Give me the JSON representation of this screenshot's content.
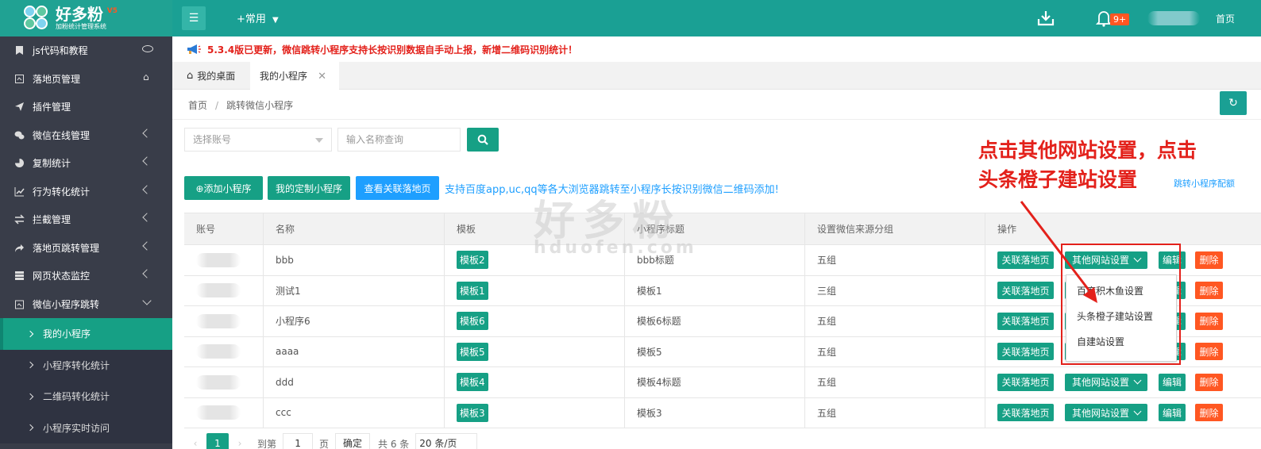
{
  "header": {
    "logo_title": "好多粉",
    "logo_version": "V5",
    "logo_subtitle": "加粉统计管理系统",
    "common_menu": "+常用",
    "badge": "9+",
    "home_link": "首页"
  },
  "sidebar": {
    "items": [
      {
        "label": "js代码和教程",
        "icon": "bookmark-icon",
        "suffix": "eye"
      },
      {
        "label": "落地页管理",
        "icon": "page-icon",
        "suffix": "home"
      },
      {
        "label": "插件管理",
        "icon": "send-icon",
        "suffix": ""
      },
      {
        "label": "微信在线管理",
        "icon": "wechat-icon",
        "suffix": "arrow"
      },
      {
        "label": "复制统计",
        "icon": "pie-icon",
        "suffix": "arrow"
      },
      {
        "label": "行为转化统计",
        "icon": "chart-line-icon",
        "suffix": "arrow"
      },
      {
        "label": "拦截管理",
        "icon": "exchange-icon",
        "suffix": "arrow"
      },
      {
        "label": "落地页跳转管理",
        "icon": "share-icon",
        "suffix": "arrow"
      },
      {
        "label": "网页状态监控",
        "icon": "server-icon",
        "suffix": "arrow"
      },
      {
        "label": "微信小程序跳转",
        "icon": "calendar-icon",
        "suffix": "down"
      }
    ],
    "sub_items": [
      {
        "label": "我的小程序",
        "active": true
      },
      {
        "label": "小程序转化统计",
        "active": false
      },
      {
        "label": "二维码转化统计",
        "active": false
      },
      {
        "label": "小程序实时访问",
        "active": false
      }
    ]
  },
  "notice": {
    "text": "5.3.4版已更新，微信跳转小程序支持长按识别数据自手动上报，新增二维码识别统计！"
  },
  "tabs": {
    "home": "我的桌面",
    "active": "我的小程序",
    "close": "✕"
  },
  "breadcrumb": {
    "home": "首页",
    "sep": "/",
    "current": "跳转微信小程序"
  },
  "search": {
    "account_placeholder": "选择账号",
    "name_placeholder": "输入名称查询"
  },
  "actions": {
    "add": "⊕添加小程序",
    "custom": "我的定制小程序",
    "view": "查看关联落地页",
    "promo": "支持百度app,uc,qq等各大浏览器跳转至小程序长按识别微信二维码添加!",
    "right_link": "跳转小程序配额"
  },
  "annotation": {
    "line1": "点击其他网站设置，点击",
    "line2": "头条橙子建站设置"
  },
  "watermark": {
    "text": "好多粉",
    "url": "hduofen.com"
  },
  "table": {
    "headers": [
      "账号",
      "名称",
      "模板",
      "小程序标题",
      "设置微信来源分组",
      "操作"
    ],
    "rows": [
      {
        "name": "bbb",
        "template": "模板2",
        "title": "bbb标题",
        "group": "五组"
      },
      {
        "name": "测试1",
        "template": "模板1",
        "title": "模板1",
        "group": "三组"
      },
      {
        "name": "小程序6",
        "template": "模板6",
        "title": "模板6标题",
        "group": "五组"
      },
      {
        "name": "aaaa",
        "template": "模板5",
        "title": "模板5",
        "group": "五组"
      },
      {
        "name": "ddd",
        "template": "模板4",
        "title": "模板4标题",
        "group": "五组"
      },
      {
        "name": "ccc",
        "template": "模板3",
        "title": "模板3",
        "group": "五组"
      }
    ],
    "op_link": "关联落地页",
    "op_other": "其他网站设置",
    "op_edit": "编辑",
    "op_delete": "删除"
  },
  "dropdown": {
    "items": [
      "百度积木鱼设置",
      "头条橙子建站设置",
      "自建站设置"
    ]
  },
  "pagination": {
    "current": "1",
    "goto_label": "到第",
    "goto_value": "1",
    "page_unit": "页",
    "ok": "确定",
    "total": "共 6 条",
    "page_size": "20 条/页"
  },
  "colors": {
    "primary": "#16a085",
    "header": "#1aa094",
    "sidebar": "#393d49",
    "danger": "#ff5722",
    "blue": "#1e9fff",
    "annotation": "#e3211b"
  }
}
